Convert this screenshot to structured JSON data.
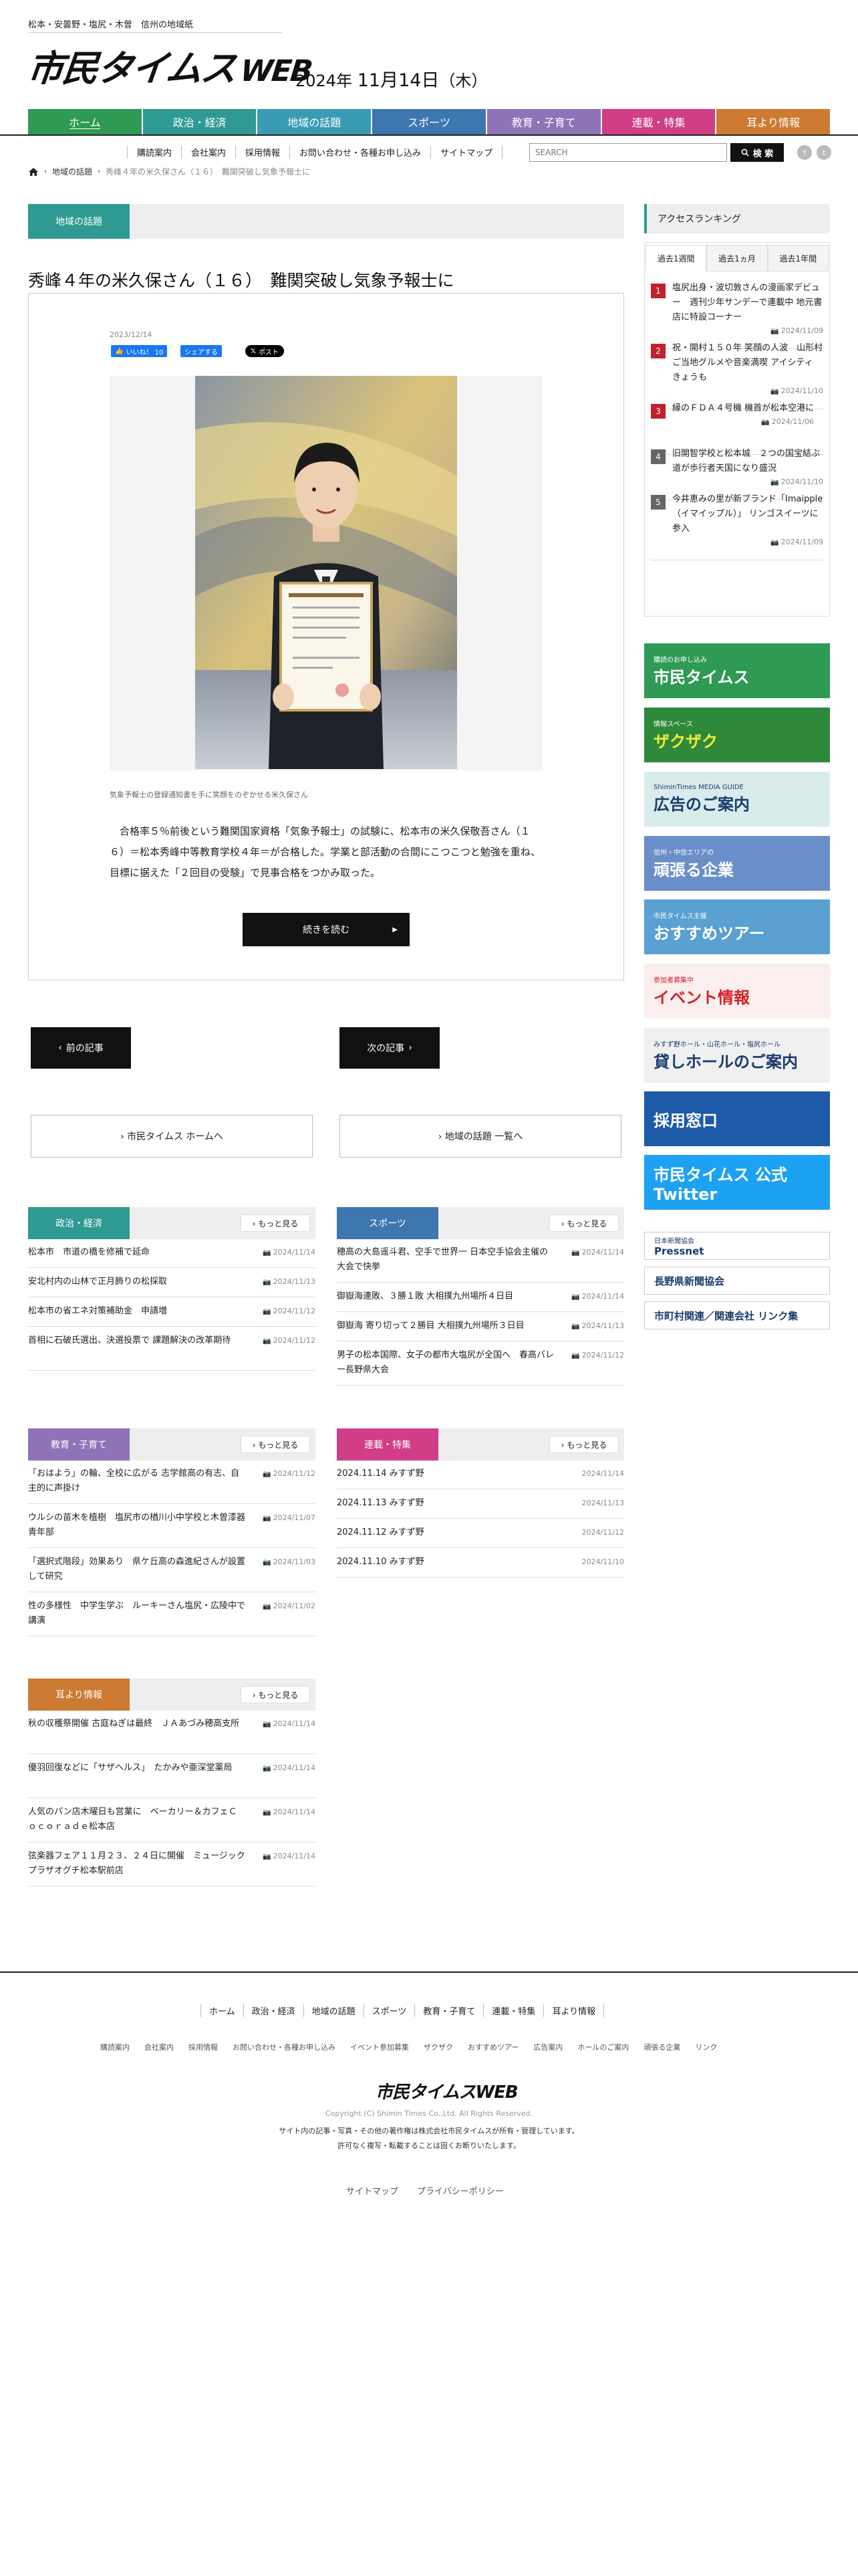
{
  "header": {
    "tagline": "松本・安曇野・塩尻・木曽　信州の地域紙",
    "logo": "市民タイムス",
    "logo_web": "WEB",
    "date_year": "2024年",
    "date_md": "11月14日",
    "date_dow": "（木）"
  },
  "nav": [
    {
      "label": "ホーム",
      "color": "#2e9a54"
    },
    {
      "label": "政治・経済",
      "color": "#2f9a92"
    },
    {
      "label": "地域の話題",
      "color": "#3a9bb5"
    },
    {
      "label": "スポーツ",
      "color": "#3e77b0"
    },
    {
      "label": "教育・子育て",
      "color": "#8f73b8"
    },
    {
      "label": "連載・特集",
      "color": "#cf3e86"
    },
    {
      "label": "耳より情報",
      "color": "#cd7a33"
    }
  ],
  "subnav": [
    "購読案内",
    "会社案内",
    "採用情報",
    "お問い合わせ・各種お申し込み",
    "サイトマップ"
  ],
  "search": {
    "placeholder": "SEARCH",
    "button": "検 索"
  },
  "breadcrumb": {
    "home": "地域の話題",
    "current": "秀峰４年の米久保さん（１６）　難関突破し気象予報士に"
  },
  "category_label": "地域の話題",
  "article": {
    "title": "秀峰４年の米久保さん（１６）　難関突破し気象予報士に",
    "date": "2023/12/14",
    "like_label": "いいね！ 10",
    "share_label": "シェアする",
    "post_label": "ポスト",
    "caption": "気象予報士の登録通知書を手に笑顔をのぞかせる米久保さん",
    "body": "　合格率５％前後という難関国家資格「気象予報士」の試験に、松本市の米久保敬吾さん（１６）＝松本秀峰中等教育学校４年＝が合格した。学業と部活動の合間にこつこつと勉強を重ね、目標に据えた「２回目の受験」で見事合格をつかみ取った。",
    "read_more": "続きを読む"
  },
  "pager": {
    "prev": "前の記事",
    "next": "次の記事",
    "home": "› 市民タイムス ホームへ",
    "list": "› 地域の話題 一覧へ"
  },
  "more_label": "› もっと見る",
  "sections": [
    {
      "label": "政治・経済",
      "color": "#2f9a92",
      "items": [
        {
          "text": "松本市　市道の橋を修補で延命",
          "date": "2024/11/14",
          "cam": true
        },
        {
          "text": "安北村内の山林で正月飾りの松採取",
          "date": "2024/11/13",
          "cam": true
        },
        {
          "text": "松本市の省エネ対策補助金　申請増",
          "date": "2024/11/12",
          "cam": true
        },
        {
          "text": "首相に石破氏選出、決選投票で 課題解決の改革期待",
          "date": "2024/11/12",
          "cam": true
        }
      ]
    },
    {
      "label": "スポーツ",
      "color": "#3e77b0",
      "items": [
        {
          "text": "穂高の大島遥斗君、空手で世界一 日本空手協会主催の大会で快挙",
          "date": "2024/11/14",
          "cam": true
        },
        {
          "text": "御嶽海連敗、３勝１敗 大相撲九州場所４日目",
          "date": "2024/11/14",
          "cam": true
        },
        {
          "text": "御嶽海 寄り切って２勝目 大相撲九州場所３日目",
          "date": "2024/11/13",
          "cam": true
        },
        {
          "text": "男子の松本国際、女子の都市大塩尻が全国へ　春高バレー長野県大会",
          "date": "2024/11/12",
          "cam": true
        }
      ]
    },
    {
      "label": "教育・子育て",
      "color": "#8f73b8",
      "items": [
        {
          "text": "「おはよう」の輪、全校に広がる 志学館高の有志、自主的に声掛け",
          "date": "2024/11/12",
          "cam": true
        },
        {
          "text": "ウルシの苗木を植樹　塩尻市の楢川小中学校と木曽漆器青年部",
          "date": "2024/11/07",
          "cam": true
        },
        {
          "text": "「選択式階段」効果あり　県ケ丘高の森進紀さんが設置して研究",
          "date": "2024/11/03",
          "cam": true
        },
        {
          "text": "性の多様性　中学生学ぶ　ルーキーさん塩尻・広陵中で講演",
          "date": "2024/11/02",
          "cam": true
        }
      ]
    },
    {
      "label": "連載・特集",
      "color": "#cf3e86",
      "items": [
        {
          "text": "2024.11.14 みすず野",
          "date": "2024/11/14",
          "cam": false
        },
        {
          "text": "2024.11.13 みすず野",
          "date": "2024/11/13",
          "cam": false
        },
        {
          "text": "2024.11.12 みすず野",
          "date": "2024/11/12",
          "cam": false
        },
        {
          "text": "2024.11.10 みすず野",
          "date": "2024/11/10",
          "cam": false
        }
      ]
    },
    {
      "label": "耳より情報",
      "color": "#cd7a33",
      "items": [
        {
          "text": "秋の収穫祭開催 古庭ねぎは最終　ＪＡあづみ穂高支所",
          "date": "2024/11/14",
          "cam": true
        },
        {
          "text": "優羽回復などに「サザヘルス」　たかみや亜深堂薬局",
          "date": "2024/11/14",
          "cam": true
        },
        {
          "text": "人気のパン店木曜日も営業に　ベーカリー＆カフェＣｏｃｏｒａｄｅ松本店",
          "date": "2024/11/14",
          "cam": true
        },
        {
          "text": "弦楽器フェア１１月２３、２４日に開催　ミュージックプラザオグチ松本駅前店",
          "date": "2024/11/14",
          "cam": true
        }
      ]
    }
  ],
  "ranking": {
    "title": "アクセスランキング",
    "tabs": [
      "過去1週間",
      "過去1ヵ月",
      "過去1年間"
    ],
    "items": [
      {
        "num": "1",
        "color": "#c0212e",
        "text": "塩尻出身・波切敦さんの漫画家デビュー　週刊少年サンデーで連載中 地元書店に特設コーナー",
        "date": "2024/11/09"
      },
      {
        "num": "2",
        "color": "#c0212e",
        "text": "祝・開村１５０年 笑顔の人波　山形村　ご当地グルメや音楽満喫 アイシティ きょうも",
        "date": "2024/11/10"
      },
      {
        "num": "3",
        "color": "#c0212e",
        "text": "縁のＦＤＡ４号機 機首が松本空港に",
        "date": "2024/11/06"
      },
      {
        "num": "4",
        "color": "#666666",
        "text": "旧開智学校と松本城　２つの国宝結ぶ道が歩行者天国になり盛況",
        "date": "2024/11/10"
      },
      {
        "num": "5",
        "color": "#666666",
        "text": "今井恵みの里が新ブランド「Imaipple（イマイップル）」 リンゴスイーツに参入",
        "date": "2024/11/09"
      }
    ]
  },
  "banners": [
    {
      "title": "市民タイムス",
      "sub": "購読のお申し込み",
      "bg": "#2e9a54"
    },
    {
      "title": "ザクザク",
      "sub": "情報スペース",
      "bg": "#2e8a3a"
    },
    {
      "title": "広告のご案内",
      "sub": "ShiminTimes MEDIA GUIDE",
      "bg": "#d9ecec"
    },
    {
      "title": "頑張る企業",
      "sub": "信州・中信エリアの",
      "bg": "#6a8fc8"
    },
    {
      "title": "おすすめツアー",
      "sub": "市民タイムス主催",
      "bg": "#5aa0d0"
    },
    {
      "title": "イベント情報",
      "sub": "参加者募集中",
      "bg": "#fbeeee"
    },
    {
      "title": "貸しホールのご案内",
      "sub": "みすず野ホール・山花ホール・塩尻ホール",
      "bg": "#f0f0f0"
    },
    {
      "title": "採用窓口",
      "sub": "",
      "bg": "#1d5aa8"
    },
    {
      "title": "市民タイムス 公式Twitter",
      "sub": "",
      "bg": "#1da1f2"
    },
    {
      "title": "Pressnet",
      "sub": "日本新聞協会",
      "bg": "#ffffff"
    },
    {
      "title": "長野県新聞協会",
      "sub": "",
      "bg": "#ffffff"
    },
    {
      "title": "市町村関連／関連会社 リンク集",
      "sub": "",
      "bg": "#ffffff"
    }
  ],
  "footer": {
    "nav": [
      "ホーム",
      "政治・経済",
      "地域の話題",
      "スポーツ",
      "教育・子育て",
      "連載・特集",
      "耳より情報"
    ],
    "nav2": [
      "購読案内",
      "会社案内",
      "採用情報",
      "お問い合わせ・各種お申し込み",
      "イベント参加募集",
      "ザクザク",
      "おすすめツアー",
      "広告案内",
      "ホールのご案内",
      "頑張る企業",
      "リンク"
    ],
    "logo": "市民タイムスWEB",
    "copyright": "Copyright (C) Shimin Times Co.,Ltd. All Rights Reserved.",
    "notice1": "サイト内の記事・写真・その他の著作権は株式会社市民タイムスが所有・管理しています。",
    "notice2": "許可なく複写・転載することは固くお断りいたします。",
    "bottom": [
      "サイトマップ",
      "プライバシーポリシー"
    ]
  }
}
